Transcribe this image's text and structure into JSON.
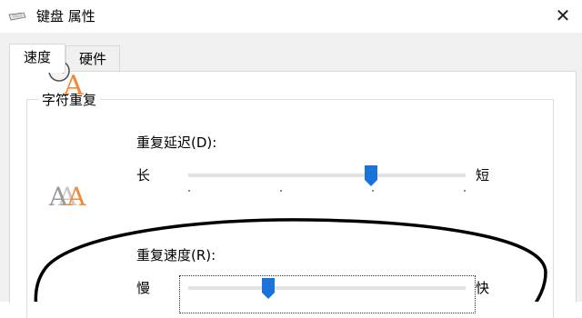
{
  "window": {
    "title": "键盘 属性",
    "close_glyph": "✕"
  },
  "tabs": [
    {
      "label": "速度",
      "selected": true
    },
    {
      "label": "硬件",
      "selected": false
    }
  ],
  "group": {
    "title": "字符重复",
    "repeat_delay": {
      "label": "重复延迟(D):",
      "min_label": "长",
      "max_label": "短",
      "value_fraction": 0.66
    },
    "repeat_rate": {
      "label": "重复速度(R):",
      "min_label": "慢",
      "max_label": "快",
      "value_fraction": 0.29
    }
  },
  "icons": {
    "app": "keyboard-icon",
    "delay": "stopwatch-letter-icon",
    "rate": "repeated-letters-icon"
  },
  "annotation": {
    "shape": "hand-drawn-ellipse",
    "color": "#000000"
  },
  "colors": {
    "slider_thumb": "#1a73d9",
    "track": "#e3e3e3",
    "glyph_a": "#f08a3c"
  }
}
